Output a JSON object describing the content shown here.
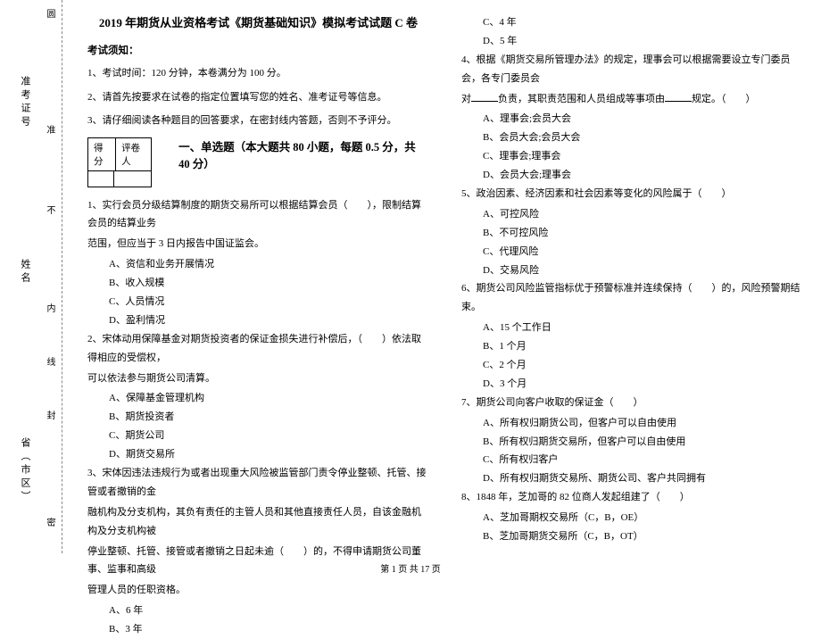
{
  "margin": {
    "seal_top": "圆",
    "admission_label": "准考证号",
    "seal_mid": "准",
    "nocut": "不",
    "name_label": "姓名",
    "nei": "内",
    "line": "线",
    "feng": "封",
    "province_label": "省（市区）",
    "mi": "密"
  },
  "title": "2019 年期货从业资格考试《期货基础知识》模拟考试试题 C 卷",
  "notice": {
    "heading": "考试须知：",
    "line1": "1、考试时间：120 分钟，本卷满分为 100 分。",
    "line2": "2、请首先按要求在试卷的指定位置填写您的姓名、准考证号等信息。",
    "line3": "3、请仔细阅读各种题目的回答要求，在密封线内答题，否则不予评分。"
  },
  "score": {
    "c1": "得分",
    "c2": "评卷人"
  },
  "section1_title": "一、单选题（本大题共 80 小题，每题 0.5 分，共 40 分）",
  "q1": {
    "stem1": "1、实行会员分级结算制度的期货交易所可以根据结算会员（　　），限制结算会员的结算业务",
    "stem2": "范围，但应当于 3 日内报告中国证监会。",
    "a": "A、资信和业务开展情况",
    "b": "B、收入规模",
    "c": "C、人员情况",
    "d": "D、盈利情况"
  },
  "q2": {
    "stem1": "2、宋体动用保障基金对期货投资者的保证金损失进行补偿后，（　　）依法取得相应的受偿权，",
    "stem2": "可以依法参与期货公司清算。",
    "a": "A、保障基金管理机构",
    "b": "B、期货投资者",
    "c": "C、期货公司",
    "d": "D、期货交易所"
  },
  "q3": {
    "stem1": "3、宋体因违法违规行为或者出现重大风险被监管部门责令停业整顿、托管、接管或者撤销的金",
    "stem2": "融机构及分支机构，其负有责任的主管人员和其他直接责任人员，自该金融机构及分支机构被",
    "stem3": "停业整顿、托管、接管或者撤销之日起未逾（　　）的，不得申请期货公司董事、监事和高级",
    "stem4": "管理人员的任职资格。",
    "a": "A、6 年",
    "b": "B、3 年",
    "c": "C、4 年",
    "d": "D、5 年"
  },
  "q4": {
    "stem1": "4、根据《期货交易所管理办法》的规定，理事会可以根据需要设立专门委员会，各专门委员会",
    "stem2_pre": "对",
    "stem2_post": "负责，其职责范围和人员组成等事项由",
    "stem2_end": "规定。（　　）",
    "a": "A、理事会;会员大会",
    "b": "B、会员大会;会员大会",
    "c": "C、理事会;理事会",
    "d": "D、会员大会;理事会"
  },
  "q5": {
    "stem": "5、政治因素、经济因素和社会因素等变化的风险属于（　　）",
    "a": "A、可控风险",
    "b": "B、不可控风险",
    "c": "C、代理风险",
    "d": "D、交易风险"
  },
  "q6": {
    "stem": "6、期货公司风险监管指标优于预警标准并连续保持（　　）的，风险预警期结束。",
    "a": "A、15 个工作日",
    "b": "B、1 个月",
    "c": "C、2 个月",
    "d": "D、3 个月"
  },
  "q7": {
    "stem": "7、期货公司向客户收取的保证金（　　）",
    "a": "A、所有权归期货公司，但客户可以自由使用",
    "b": "B、所有权归期货交易所，但客户可以自由使用",
    "c": "C、所有权归客户",
    "d": "D、所有权归期货交易所、期货公司、客户共同拥有"
  },
  "q8": {
    "stem": "8、1848 年，芝加哥的 82 位商人发起组建了（　　）",
    "a": "A、芝加哥期权交易所（C，B，OE）",
    "b": "B、芝加哥期货交易所（C，B，OT）"
  },
  "footer": "第 1 页 共 17 页"
}
